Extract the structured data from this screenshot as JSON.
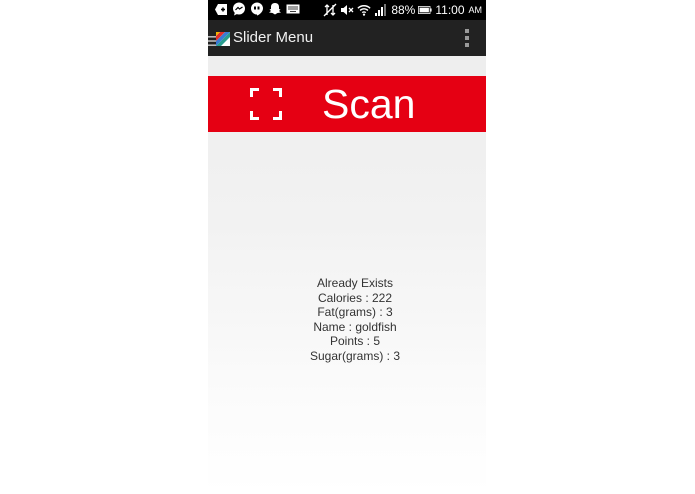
{
  "status_bar": {
    "battery": "88%",
    "time": "11:00",
    "ampm": "AM"
  },
  "action_bar": {
    "title": "Slider Menu"
  },
  "scan_button": {
    "label": "Scan"
  },
  "result": {
    "lines": [
      "Already Exists",
      "Calories : 222",
      "Fat(grams) : 3",
      "Name : goldfish",
      "Points : 5",
      "Sugar(grams) : 3"
    ]
  },
  "colors": {
    "scan_red": "#e50013",
    "action_bar": "#222222",
    "status_bar": "#000000"
  }
}
